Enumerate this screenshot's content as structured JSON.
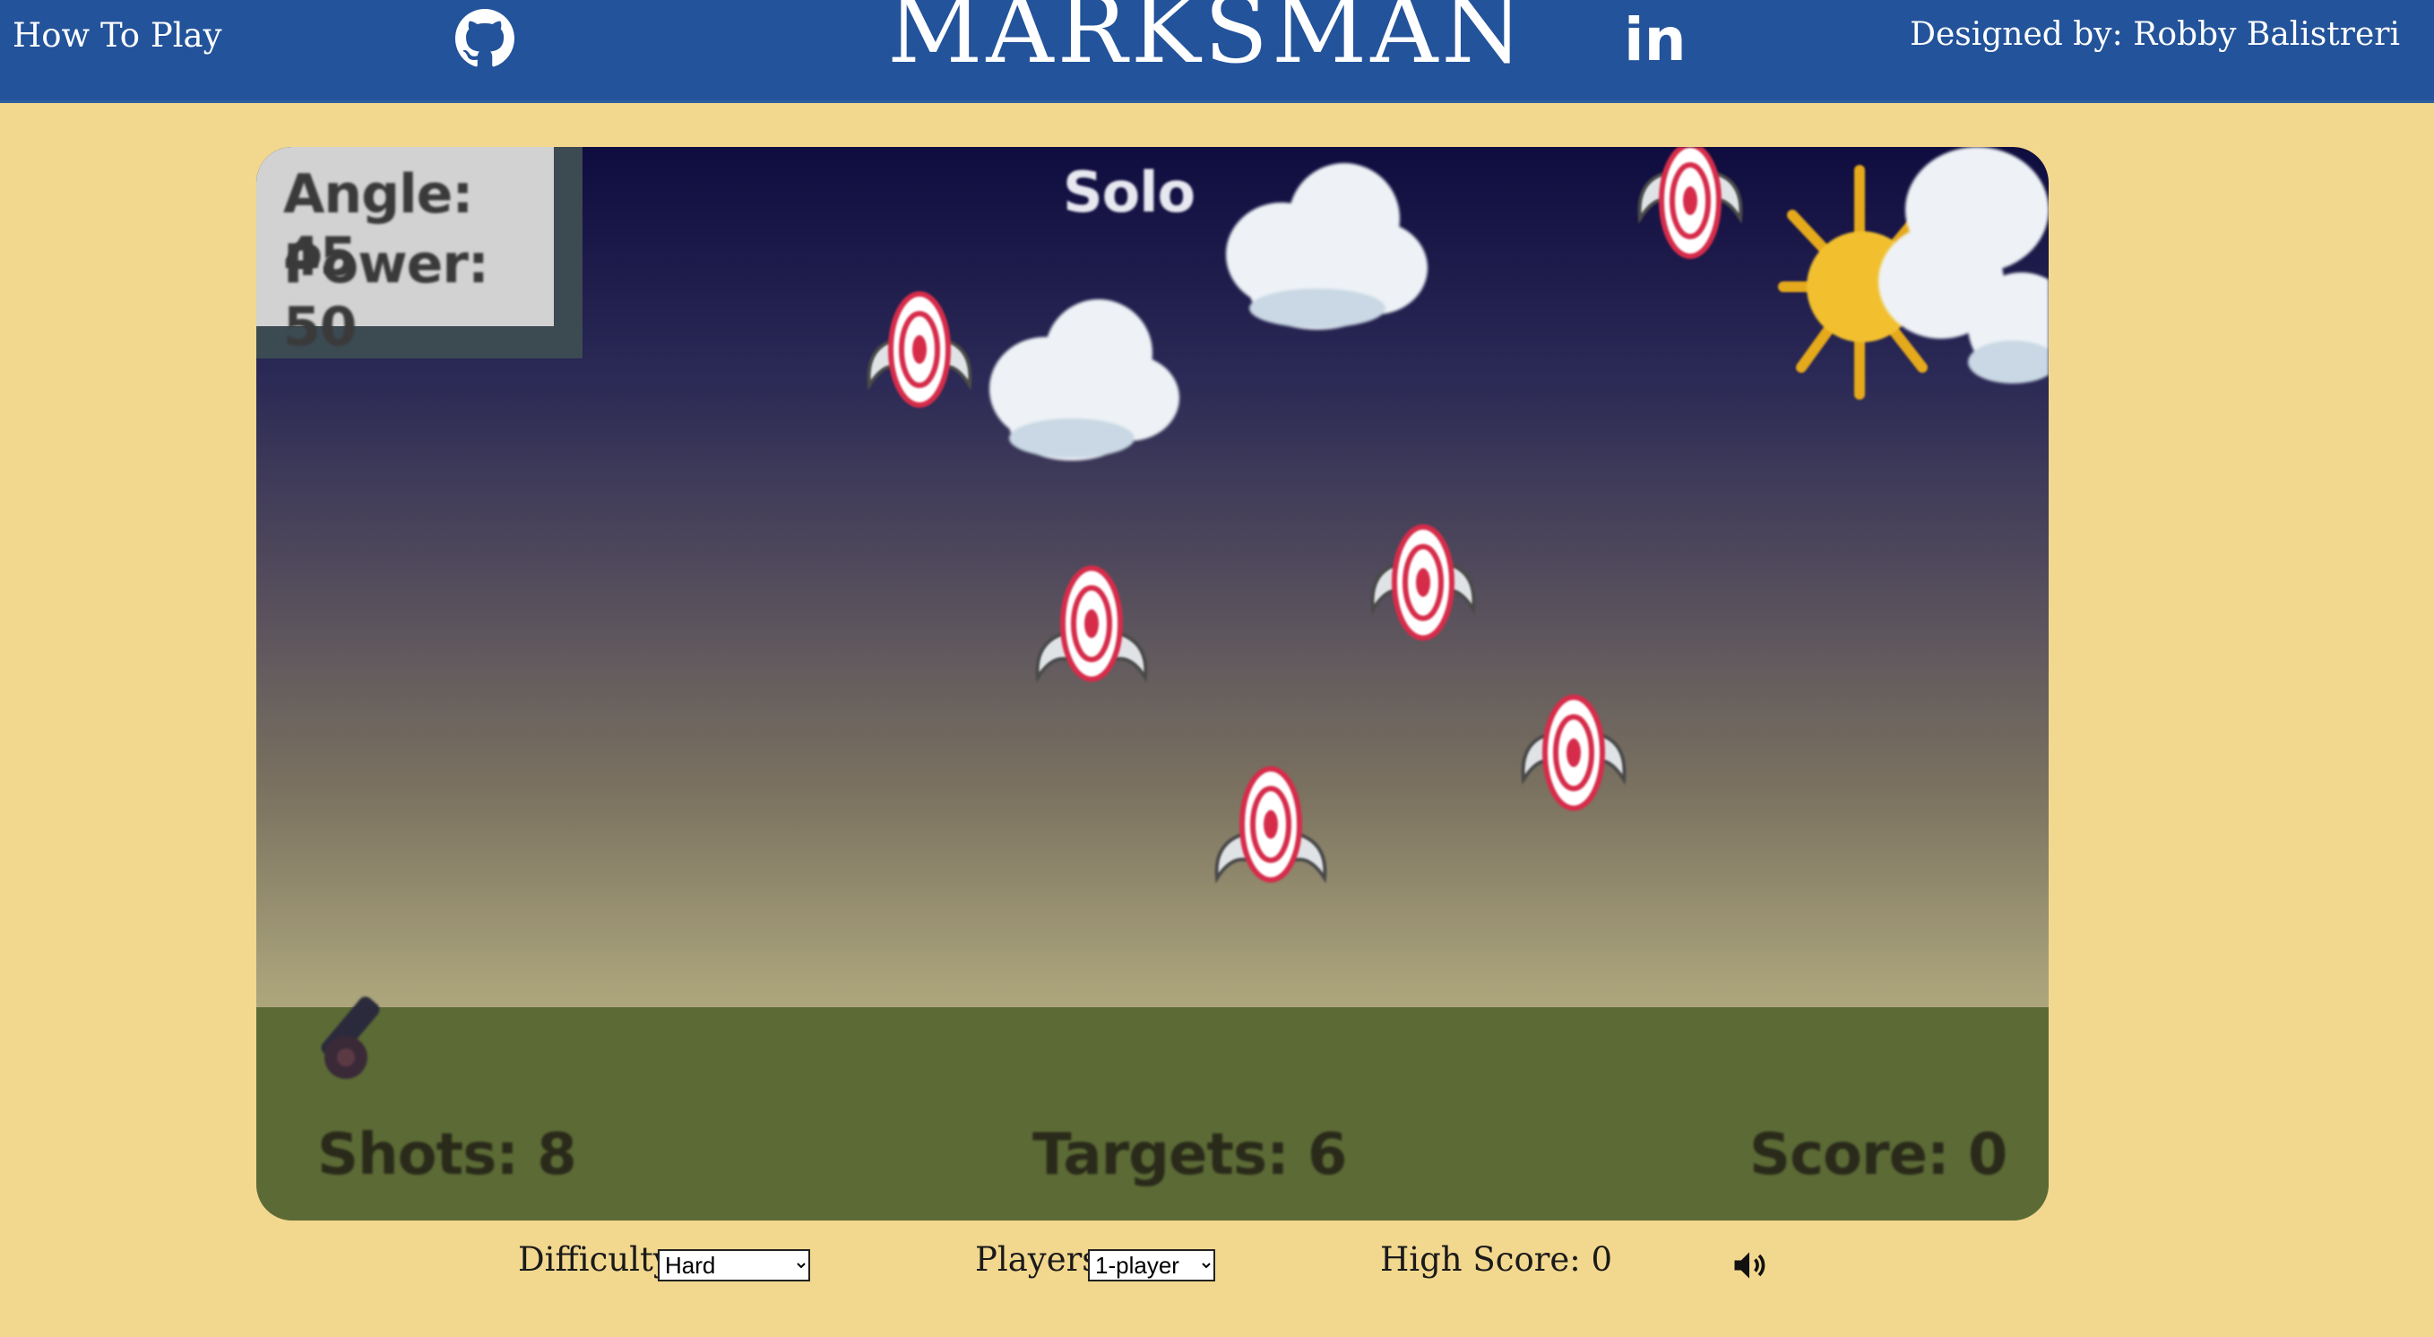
{
  "header": {
    "how_to_play": "How To Play",
    "title": "MARKSMAN",
    "designer": "Designed by: Robby Balistreri",
    "icons": [
      "github-icon",
      "linkedin-icon"
    ],
    "linkedin_glyph": "in"
  },
  "game": {
    "angle_label": "Angle: 45",
    "power_label": "Power: 50",
    "mode_label": "Solo",
    "shots_label": "Shots: 8",
    "targets_label": "Targets: 6",
    "score_label": "Score: 0",
    "target_count": 6,
    "colors": {
      "sky_top": "#0f0c3f",
      "sky_bottom": "#cab986",
      "ground": "#5c6b36",
      "target_red": "#d62c4a"
    }
  },
  "controls": {
    "difficulty_label": "Difficulty",
    "difficulty_value": "Hard",
    "players_label": "Players",
    "players_value": "1-player",
    "high_score_label": "High Score: 0",
    "sound_icon": "speaker-icon"
  },
  "colors": {
    "header_bg": "#23539a",
    "page_bg": "#f2d78e"
  }
}
